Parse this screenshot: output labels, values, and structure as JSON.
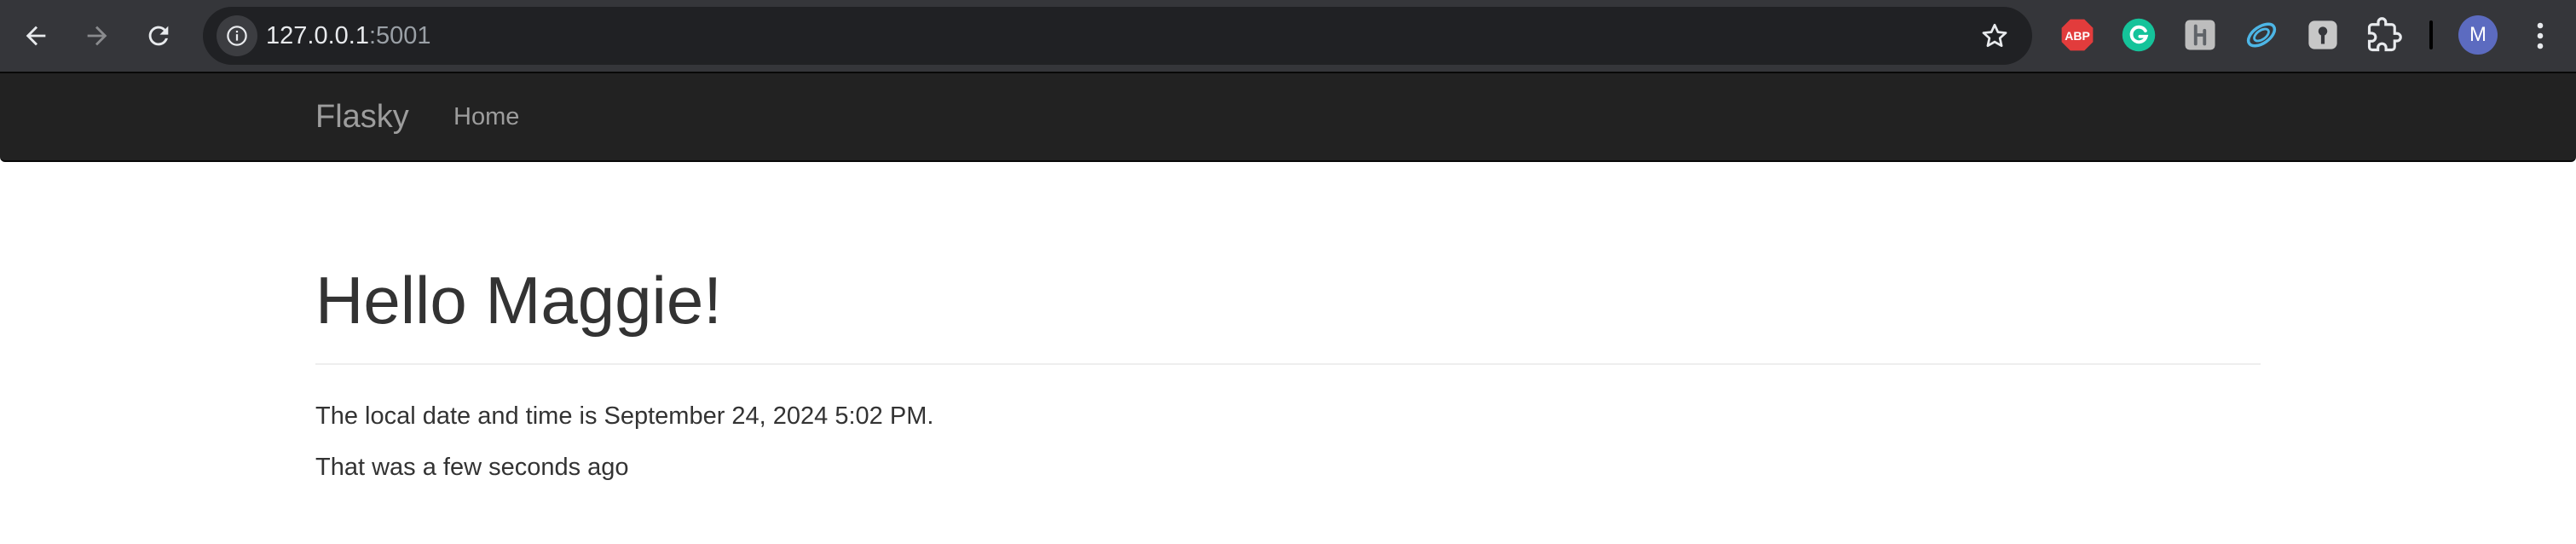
{
  "browser": {
    "url": {
      "host": "127.0.0.1",
      "port": ":5001"
    },
    "profile_initial": "M",
    "extensions": [
      {
        "name": "adblock-plus",
        "label": "ABP",
        "color": "#e23c3c"
      },
      {
        "name": "grammarly",
        "color": "#15c39a"
      },
      {
        "name": "honey",
        "color": "#bdbdbd"
      },
      {
        "name": "sync",
        "color": "#4db6e6"
      },
      {
        "name": "keyhole",
        "color": "#c7c7c7"
      },
      {
        "name": "extensions-puzzle",
        "color": "#e8eaed"
      }
    ],
    "icons": [
      "back-arrow-icon",
      "forward-arrow-icon",
      "reload-icon",
      "site-info-icon",
      "star-icon",
      "kebab-menu-icon"
    ]
  },
  "navbar": {
    "brand": "Flasky",
    "links": [
      {
        "label": "Home"
      }
    ],
    "background": "#222222",
    "text_color": "#9d9d9d"
  },
  "main": {
    "greeting": "Hello Maggie!",
    "local_datetime": "The local date and time is September 24, 2024 5:02 PM.",
    "relative_time": "That was a few seconds ago"
  }
}
